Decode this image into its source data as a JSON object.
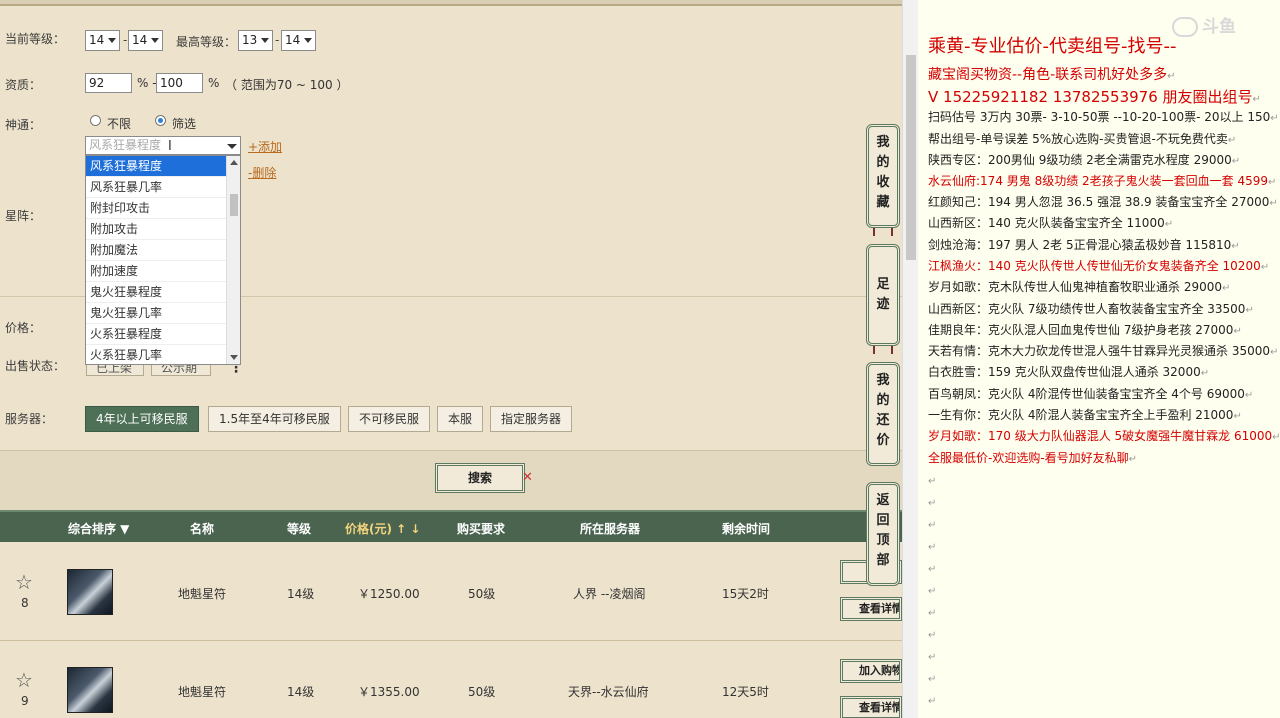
{
  "filters": {
    "current_level_label": "当前等级：",
    "current_level_min": "14",
    "current_level_max": "14",
    "level_sep": "-",
    "max_level_label": "最高等级：",
    "max_level_min": "13",
    "max_level_max": "14",
    "aptitude_label": "资质：",
    "aptitude_min": "92",
    "aptitude_max": "100",
    "percent": "%",
    "aptitude_sep": "% -",
    "aptitude_range": "（ 范围为70 ~ 100 ）",
    "shentong_label": "神通：",
    "radio_unlimited": "不限",
    "radio_filter": "筛选",
    "dropdown_placeholder": "风系狂暴程度",
    "add_link": "+添加",
    "delete_link": "-删除",
    "star_formation_label": "星阵：",
    "price_label": "价格：",
    "sale_status_label": "出售状态：",
    "sale_btn_1": "已上架",
    "sale_btn_2": "公示期",
    "sale_more": "⋮",
    "server_label": "服务器：",
    "server_buttons": [
      "4年以上可移民服",
      "1.5年至4年可移民服",
      "不可移民服",
      "本服",
      "指定服务器"
    ]
  },
  "dropdown_options": [
    "风系狂暴程度",
    "风系狂暴几率",
    "附封印攻击",
    "附加攻击",
    "附加魔法",
    "附加速度",
    "鬼火狂暴程度",
    "鬼火狂暴几率",
    "火系狂暴程度",
    "火系狂暴几率"
  ],
  "search": {
    "label": "搜索",
    "close": "✕"
  },
  "table": {
    "headers": {
      "sort": "综合排序 ▼",
      "name": "名称",
      "level": "等级",
      "price": "价格(元) ↑ ↓",
      "requirement": "购买要求",
      "server": "所在服务器",
      "remaining": "剩余时间"
    },
    "rows": [
      {
        "favorites": "8",
        "name": "地魁星符",
        "level": "14级",
        "price": "￥1250.00",
        "requirement": "50级",
        "server": "人界 --凌烟阁",
        "remaining": "15天2时"
      },
      {
        "favorites": "9",
        "name": "地魁星符",
        "level": "14级",
        "price": "￥1355.00",
        "requirement": "50级",
        "server": "天界--水云仙府",
        "remaining": "12天5时"
      }
    ],
    "detail_btn": "查看详情",
    "cart_btn": "加入购物车"
  },
  "side_nav": [
    {
      "chars": [
        "我",
        "的",
        "收",
        "藏"
      ]
    },
    {
      "chars": [
        "足",
        "迹"
      ]
    },
    {
      "chars": [
        "我",
        "的",
        "还",
        "价"
      ]
    },
    {
      "chars": [
        "返",
        "回",
        "顶",
        "部"
      ]
    }
  ],
  "ad": {
    "watermark": "斗鱼",
    "title": "乘黄-专业估价-代卖组号-找号--",
    "lines": [
      {
        "text": "藏宝阁买物资--角色-联系司机好处多多",
        "style": "red big"
      },
      {
        "text": "V 15225921182   13782553976 朋友圈出组号",
        "style": "phone"
      },
      {
        "text": "扫码估号 3万内 30票- 3-10-50票  --10-20-100票- 20以上 150",
        "style": ""
      },
      {
        "text": "帮出组号-单号误差 5%放心选购-买贵管退-不玩免费代卖",
        "style": ""
      },
      {
        "text": "陕西专区：200男仙 9级功绩 2老全满雷克水程度 29000",
        "style": ""
      },
      {
        "text": "水云仙府:174 男鬼 8级功绩 2老孩子鬼火装一套回血一套 4599",
        "style": "red"
      },
      {
        "text": "红颜知己：194 男人忽混 36.5 强混 38.9 装备宝宝齐全 27000",
        "style": ""
      },
      {
        "text": "山西新区：140 克火队装备宝宝齐全 11000",
        "style": ""
      },
      {
        "text": "剑烛沧海：197 男人 2老 5正骨混心猿孟极妙音 115810",
        "style": ""
      },
      {
        "text": "江枫渔火：140 克火队传世人传世仙无价女鬼装备齐全 10200",
        "style": "red"
      },
      {
        "text": "岁月如歌：克木队传世人仙鬼神植畜牧职业通杀 29000",
        "style": ""
      },
      {
        "text": "山西新区：克火队 7级功绩传世人畜牧装备宝宝齐全 33500",
        "style": ""
      },
      {
        "text": "佳期良年：克火队混人回血鬼传世仙 7级护身老孩 27000",
        "style": ""
      },
      {
        "text": "天若有情：克木大力砍龙传世混人强牛甘霖异光灵猴通杀 35000",
        "style": ""
      },
      {
        "text": "白衣胜雪：159 克火队双盘传世仙混人通杀 32000",
        "style": ""
      },
      {
        "text": "百鸟朝凤：克火队 4阶混传世仙装备宝宝齐全 4个号 69000",
        "style": ""
      },
      {
        "text": "一生有你：克火队 4阶混人装备宝宝齐全上手盈利 21000",
        "style": ""
      },
      {
        "text": "岁月如歌：170 级大力队仙器混人 5破女魔强牛魔甘霖龙 61000",
        "style": "red"
      },
      {
        "text": "全服最低价-欢迎选购-看号加好友私聊",
        "style": "red"
      }
    ],
    "paragraph_mark": "↵"
  },
  "colors": {
    "panel_bg": "#ede3cc",
    "header_green": "#4a6450",
    "accent_red": "#d40000",
    "active_server": "#4d7057"
  }
}
